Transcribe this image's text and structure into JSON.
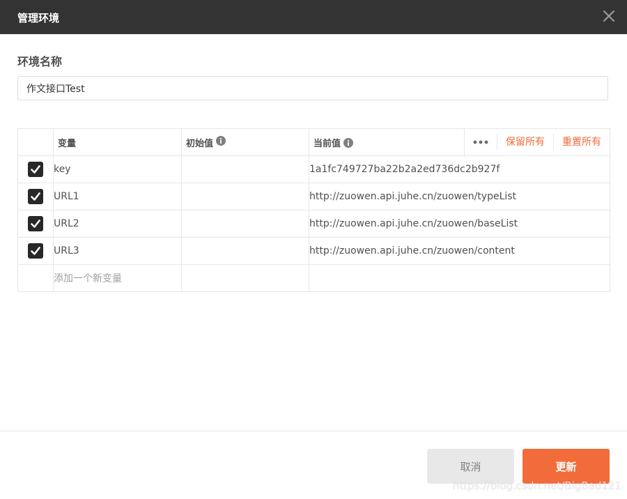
{
  "dialog": {
    "title": "管理环境",
    "close_icon": "close-icon"
  },
  "env": {
    "label": "环境名称",
    "name_value": "作文接口Test"
  },
  "table": {
    "headers": {
      "variable": "变量",
      "initial": "初始值",
      "current": "当前值"
    },
    "actions": {
      "persist_all": "保留所有",
      "reset_all": "重置所有"
    },
    "rows": [
      {
        "checked": true,
        "key": "key",
        "initial": "",
        "current": "1a1fc749727ba22b2a2ed736dc2b927f"
      },
      {
        "checked": true,
        "key": "URL1",
        "initial": "",
        "current": "http://zuowen.api.juhe.cn/zuowen/typeList"
      },
      {
        "checked": true,
        "key": "URL2",
        "initial": "",
        "current": "http://zuowen.api.juhe.cn/zuowen/baseList"
      },
      {
        "checked": true,
        "key": "URL3",
        "initial": "",
        "current": "http://zuowen.api.juhe.cn/zuowen/content"
      }
    ],
    "add_placeholder": "添加一个新变量"
  },
  "footer": {
    "cancel_label": "取消",
    "update_label": "更新"
  },
  "watermark": "https://blog.csdn.net/BigBad121",
  "colors": {
    "accent": "#f26b3a",
    "titlebar": "#333333",
    "checkbox": "#282828"
  }
}
